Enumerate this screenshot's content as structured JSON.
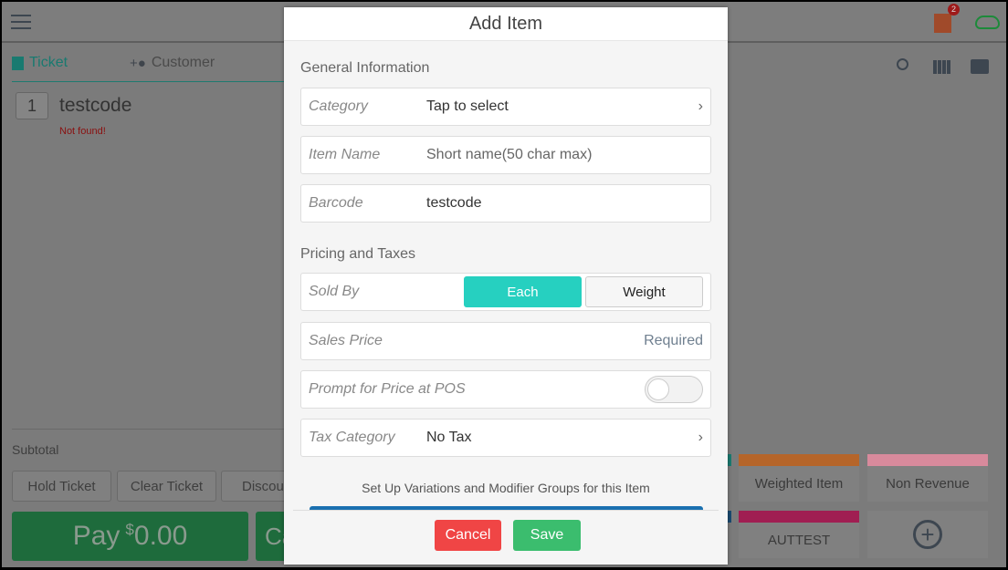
{
  "header": {
    "notification_count": "2"
  },
  "tabs": [
    {
      "label": "Ticket",
      "active": true
    },
    {
      "label": "Customer",
      "active": false
    }
  ],
  "ticket": {
    "items": [
      {
        "qty": "1",
        "name": "testcode",
        "error": "Not found!"
      }
    ],
    "subtotal_label": "Subtotal"
  },
  "actions": {
    "hold": "Hold Ticket",
    "clear": "Clear Ticket",
    "discount": "Discou",
    "pay_label": "Pay",
    "pay_currency": "$",
    "pay_amount": "0.00",
    "second": "Ca"
  },
  "tiles": [
    {
      "label": "Weighted Item",
      "color": "#b5652a"
    },
    {
      "label": "Non Revenue",
      "color": "#d88a9c"
    },
    {
      "label": "AUTTEST",
      "color": "#a01e52"
    }
  ],
  "modal": {
    "title": "Add Item",
    "general_header": "General Information",
    "category": {
      "label": "Category",
      "value": "Tap to select"
    },
    "item_name": {
      "label": "Item Name",
      "placeholder": "Short name(50 char max)"
    },
    "barcode": {
      "label": "Barcode",
      "value": "testcode"
    },
    "pricing_header": "Pricing and Taxes",
    "sold_by": {
      "label": "Sold By",
      "options": [
        "Each",
        "Weight"
      ],
      "selected": "Each"
    },
    "sales_price": {
      "label": "Sales Price",
      "placeholder": "Required"
    },
    "prompt_price": {
      "label": "Prompt for Price at POS",
      "enabled": false
    },
    "tax_category": {
      "label": "Tax Category",
      "value": "No Tax"
    },
    "variations_text": "Set Up Variations and Modifier Groups for this Item",
    "cancel": "Cancel",
    "save": "Save"
  },
  "colors": {
    "accent": "#26d0c0",
    "cancel": "#f04545",
    "save": "#3bbd6e",
    "pay": "#1e6b3c"
  }
}
